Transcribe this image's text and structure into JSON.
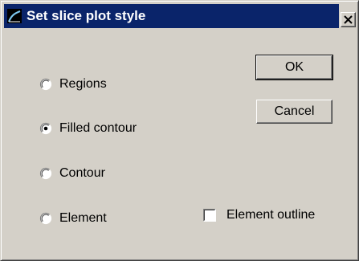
{
  "window": {
    "title": "Set slice plot style",
    "icon": "chart-curve-icon",
    "close_symbol": "close-icon"
  },
  "buttons": {
    "ok_label": "OK",
    "cancel_label": "Cancel"
  },
  "style_options": [
    {
      "label": "Regions",
      "selected": false
    },
    {
      "label": "Filled contour",
      "selected": true
    },
    {
      "label": "Contour",
      "selected": false
    },
    {
      "label": "Element",
      "selected": false
    }
  ],
  "element_outline": {
    "label": "Element outline",
    "checked": false
  },
  "colors": {
    "titlebar": "#0a246a",
    "dialog_face": "#d4d0c8"
  }
}
